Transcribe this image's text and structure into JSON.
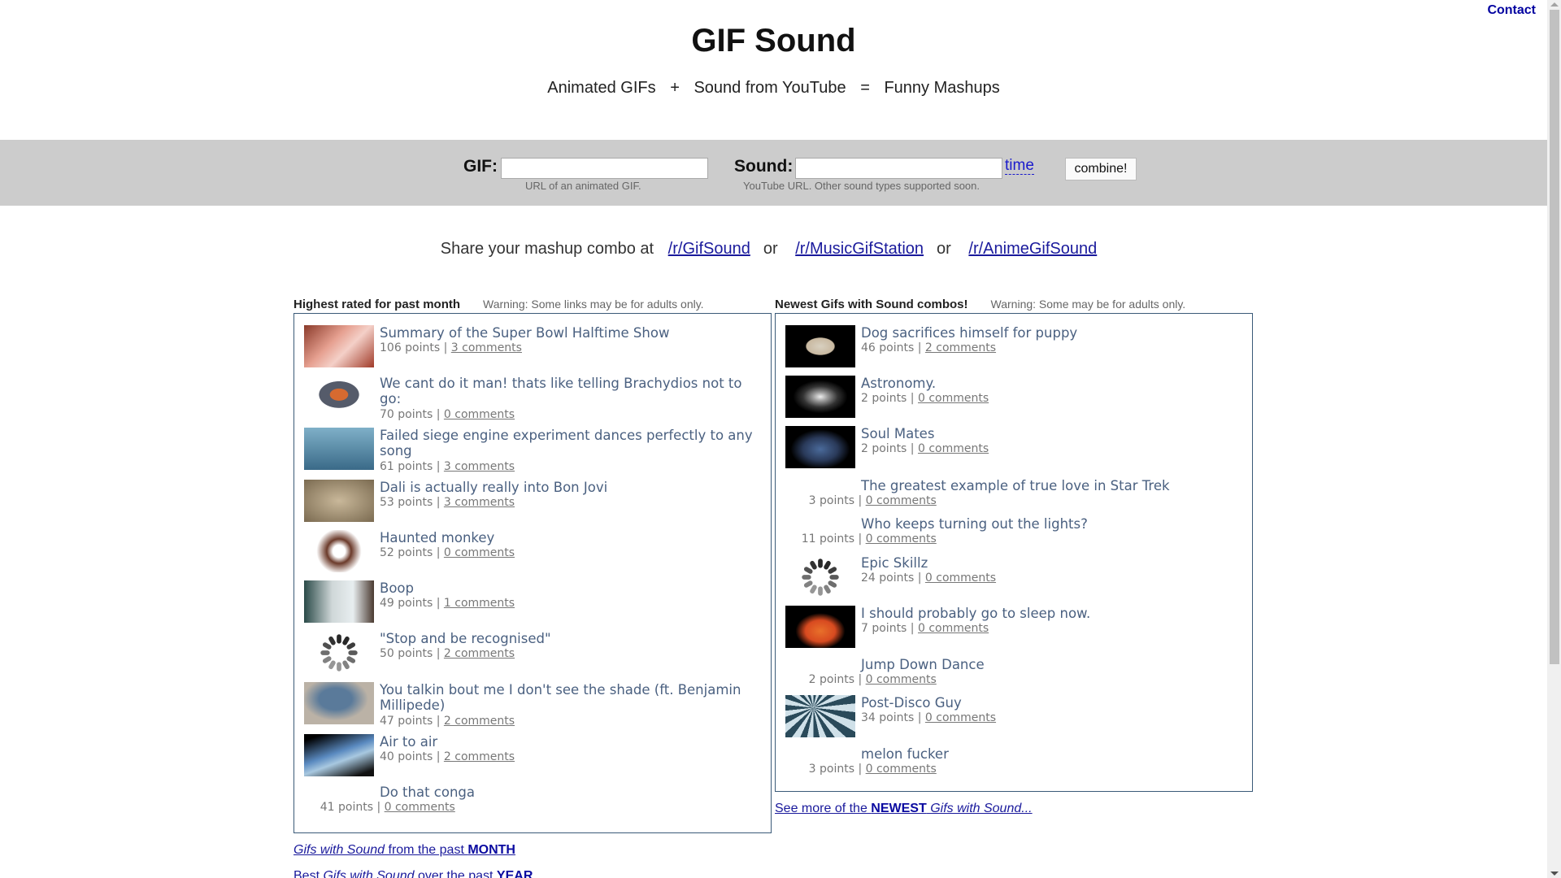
{
  "header": {
    "contact_label": "Contact",
    "title": "GIF Sound",
    "tagline": [
      "Animated GIFs",
      "+",
      "Sound from YouTube",
      "=",
      "Funny Mashups"
    ]
  },
  "form": {
    "gif_label": "GIF:",
    "gif_value": "",
    "gif_hint": "URL of an animated GIF.",
    "sound_label": "Sound:",
    "sound_value": "",
    "sound_hint": "YouTube URL. Other sound types supported soon.",
    "time_label": "time",
    "combine_label": "combine!"
  },
  "share": {
    "prefix": "Share your mashup combo at",
    "links": [
      "/r/GifSound",
      "/r/MusicGifStation",
      "/r/AnimeGifSound"
    ],
    "separator": "or"
  },
  "highest": {
    "heading": "Highest rated for past month",
    "warning": "Warning: Some links may be for adults only.",
    "items": [
      {
        "title": "Summary of the Super Bowl Halftime Show",
        "points": "106 points",
        "comments": "3 comments",
        "thumb": "stage-performance"
      },
      {
        "title": "We cant do it man! thats like telling Brachydios not to go:",
        "points": "70 points",
        "comments": "0 comments",
        "thumb": "cartoon-monster"
      },
      {
        "title": "Failed siege engine experiment dances perfectly to any song",
        "points": "61 points",
        "comments": "3 comments",
        "thumb": "siege-engine"
      },
      {
        "title": "Dali is actually really into Bon Jovi",
        "points": "53 points",
        "comments": "3 comments",
        "thumb": "face-closeup"
      },
      {
        "title": "Haunted monkey",
        "points": "52 points",
        "comments": "0 comments",
        "thumb": "monkeys-circle"
      },
      {
        "title": "Boop",
        "points": "49 points",
        "comments": "1 comments",
        "thumb": "seal-boop"
      },
      {
        "title": "\"Stop and be recognised\"",
        "points": "50 points",
        "comments": "2 comments",
        "thumb": "loading-spinner"
      },
      {
        "title": "You talkin bout me I don't see the shade (ft. Benjamin Millipede)",
        "points": "47 points",
        "comments": "2 comments",
        "thumb": "shadow-millipede"
      },
      {
        "title": "Air to air",
        "points": "40 points",
        "comments": "2 comments",
        "thumb": "cockpit"
      },
      {
        "title": "Do that conga",
        "points": "41 points",
        "comments": "0 comments",
        "thumb": "none"
      }
    ],
    "footer_links": [
      {
        "italic": "Gifs with Sound",
        "middle": " from the past ",
        "bold": "MONTH"
      },
      {
        "prefix": "Best ",
        "italic": "Gifs with Sound",
        "middle": " over the past ",
        "bold": "YEAR"
      }
    ]
  },
  "newest": {
    "heading": "Newest Gifs with Sound combos!",
    "warning": "Warning: Some may be for adults only.",
    "items": [
      {
        "title": "Dog sacrifices himself for puppy",
        "points": "46 points",
        "comments": "2 comments",
        "thumb": "dog"
      },
      {
        "title": "Astronomy.",
        "points": "2 points",
        "comments": "0 comments",
        "thumb": "galaxy"
      },
      {
        "title": "Soul Mates",
        "points": "2 points",
        "comments": "0 comments",
        "thumb": "earth-night"
      },
      {
        "title": "The greatest example of true love in Star Trek",
        "points": "3 points",
        "comments": "0 comments",
        "thumb": "none"
      },
      {
        "title": "Who keeps turning out the lights?",
        "points": "11 points",
        "comments": "0 comments",
        "thumb": "none"
      },
      {
        "title": "Epic Skillz",
        "points": "24 points",
        "comments": "0 comments",
        "thumb": "loading-spinner"
      },
      {
        "title": "I should probably go to sleep now.",
        "points": "7 points",
        "comments": "0 comments",
        "thumb": "cartoon-man"
      },
      {
        "title": "Jump Down Dance",
        "points": "2 points",
        "comments": "0 comments",
        "thumb": "none"
      },
      {
        "title": "Post-Disco Guy",
        "points": "34 points",
        "comments": "0 comments",
        "thumb": "disco-guy"
      },
      {
        "title": "melon fucker",
        "points": "3 points",
        "comments": "0 comments",
        "thumb": "none"
      }
    ],
    "see_more": {
      "prefix": "See more of the ",
      "bold": "NEWEST",
      "italic": " Gifs with Sound..."
    }
  }
}
